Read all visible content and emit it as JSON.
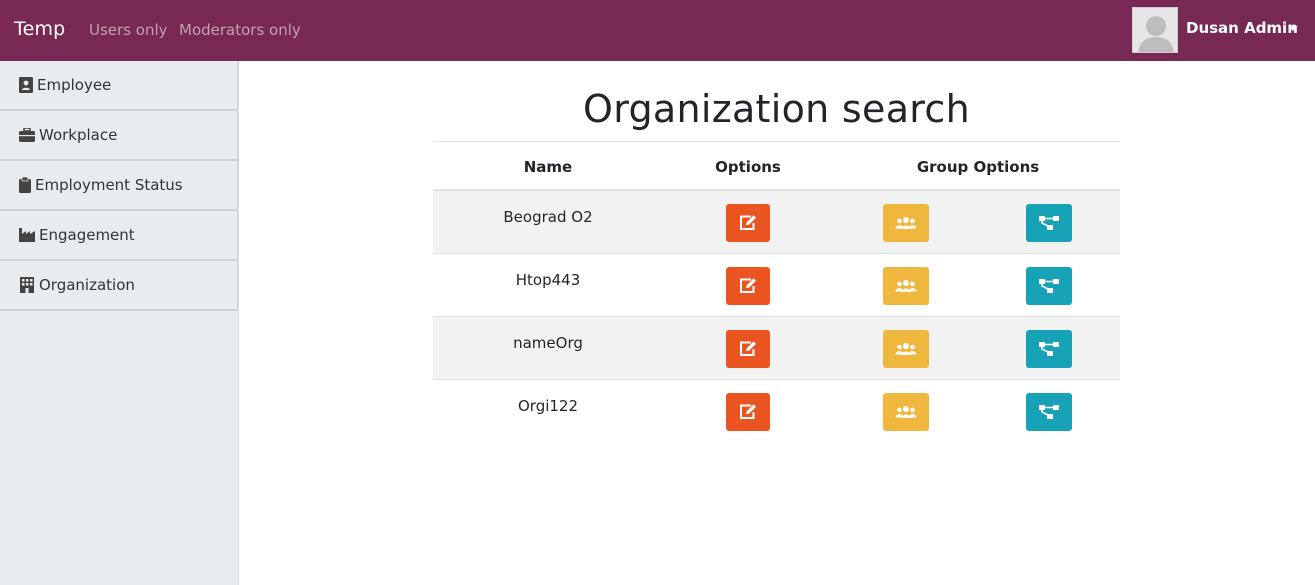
{
  "navbar": {
    "brand": "Temp",
    "links": [
      "Users only",
      "Moderators only"
    ],
    "user_name": "Dusan Admin",
    "color": "#772953"
  },
  "sidebar": {
    "items": [
      {
        "label": "Employee",
        "icon": "address-card-icon"
      },
      {
        "label": "Workplace",
        "icon": "briefcase-icon"
      },
      {
        "label": "Employment Status",
        "icon": "clipboard-icon"
      },
      {
        "label": "Engagement",
        "icon": "industry-icon"
      },
      {
        "label": "Organization",
        "icon": "building-icon"
      }
    ]
  },
  "main": {
    "title": "Organization search",
    "columns": [
      "Name",
      "Options",
      "Group Options"
    ],
    "rows": [
      {
        "name": "Beograd O2"
      },
      {
        "name": "Htop443"
      },
      {
        "name": "nameOrg"
      },
      {
        "name": "Orgi122"
      }
    ],
    "row_actions": [
      "edit-icon",
      "users-icon",
      "sitemap-icon"
    ]
  },
  "colors": {
    "edit": "#e95420",
    "group": "#efb73e",
    "tree": "#17a2b8"
  }
}
